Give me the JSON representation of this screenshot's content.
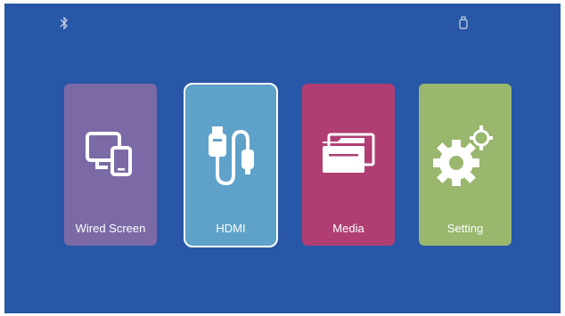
{
  "colors": {
    "background": "#2757a6",
    "wired_screen": "#7b6aa6",
    "hdmi": "#5ea1c9",
    "media": "#b03e72",
    "setting": "#99b76d"
  },
  "status_bar": {
    "left_icon": "bluetooth-icon",
    "right_icon": "usb-drive-icon"
  },
  "tiles": [
    {
      "label": "Wired Screen",
      "icon": "screen-mirror-icon",
      "selected": false
    },
    {
      "label": "HDMI",
      "icon": "hdmi-cable-icon",
      "selected": true
    },
    {
      "label": "Media",
      "icon": "folder-icon",
      "selected": false
    },
    {
      "label": "Setting",
      "icon": "gear-icon",
      "selected": false
    }
  ]
}
